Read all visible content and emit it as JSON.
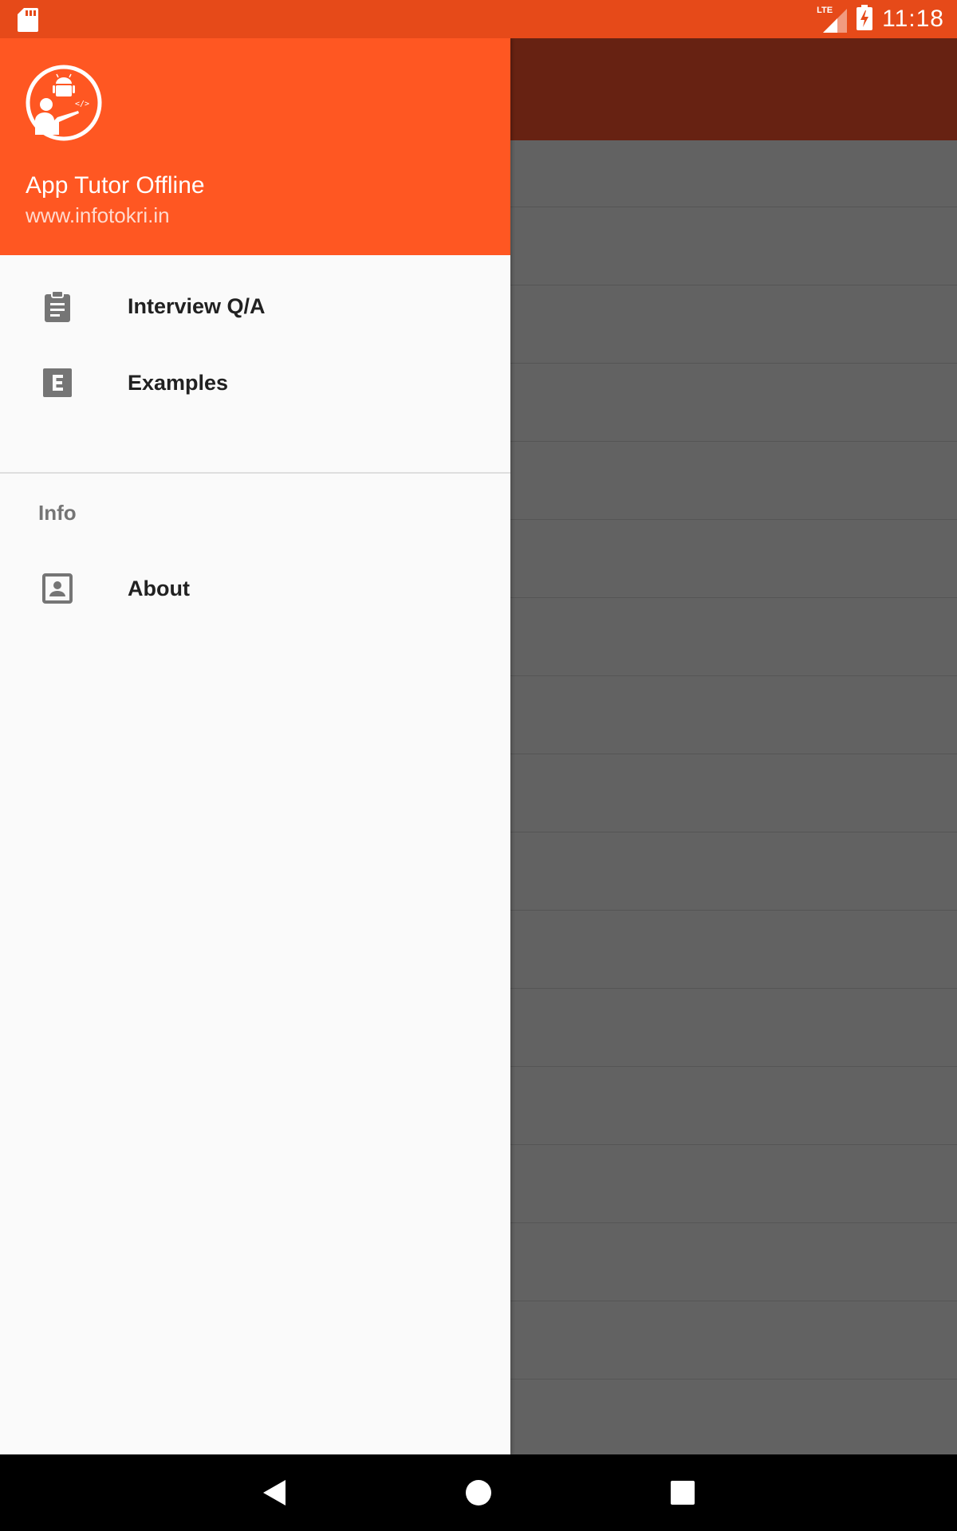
{
  "status_bar": {
    "time": "11:18",
    "network": "LTE",
    "icons": [
      "sd-card-icon",
      "lte-signal-icon",
      "battery-charging-icon"
    ]
  },
  "drawer": {
    "header": {
      "title": "App Tutor Offline",
      "subtitle": "www.infotokri.in",
      "logo_icon": "app-tutor-logo-icon"
    },
    "items": [
      {
        "label": "Interview Q/A",
        "icon": "clipboard-icon"
      },
      {
        "label": "Examples",
        "icon": "letter-e-box-icon"
      }
    ],
    "sections": [
      {
        "title": "Info",
        "items": [
          {
            "label": "About",
            "icon": "contact-card-icon"
          }
        ]
      }
    ]
  },
  "nav_bar": {
    "buttons": [
      "back-icon",
      "home-icon",
      "recents-icon"
    ]
  },
  "colors": {
    "status_bar": "#e64a19",
    "drawer_header": "#ff5722",
    "dim_toolbar": "#672212",
    "dim_content": "#626262",
    "icon_gray": "#757575"
  }
}
